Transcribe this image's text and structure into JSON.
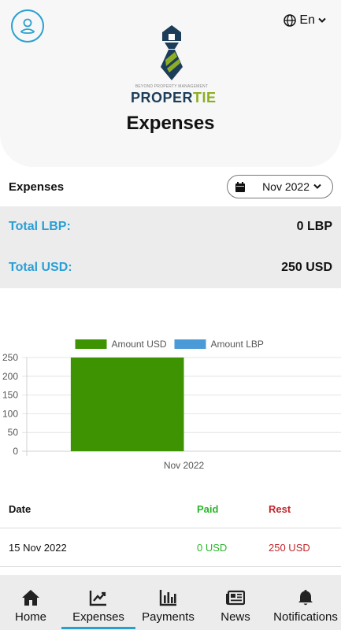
{
  "header": {
    "language": "En",
    "logo_tagline": "BEYOND PROPERTY MANAGEMENT",
    "logo_brand_main": "PROPER",
    "logo_brand_accent": "TIE",
    "title": "Expenses"
  },
  "filter": {
    "section_label": "Expenses",
    "selected_month": "Nov 2022"
  },
  "totals": [
    {
      "label": "Total LBP:",
      "value": "0 LBP"
    },
    {
      "label": "Total USD:",
      "value": "250 USD"
    }
  ],
  "chart_data": {
    "type": "bar",
    "categories": [
      "Nov 2022"
    ],
    "series": [
      {
        "name": "Amount USD",
        "values": [
          250
        ],
        "color": "#3e9303"
      },
      {
        "name": "Amount LBP",
        "values": [
          0
        ],
        "color": "#4a9ad8"
      }
    ],
    "y_ticks": [
      0,
      50,
      100,
      150,
      200,
      250
    ],
    "ylim": [
      0,
      250
    ],
    "legend": "top",
    "grid": true
  },
  "table": {
    "columns": [
      "Date",
      "Paid",
      "Rest"
    ],
    "column_colors": [
      "#111111",
      "#2ab52a",
      "#c0262b"
    ],
    "rows": [
      {
        "date": "15 Nov 2022",
        "paid": "0 USD",
        "rest": "250 USD"
      }
    ]
  },
  "nav": [
    {
      "label": "Home",
      "icon": "home-icon",
      "active": false
    },
    {
      "label": "Expenses",
      "icon": "chart-icon",
      "active": true
    },
    {
      "label": "Payments",
      "icon": "bar-chart-icon",
      "active": false
    },
    {
      "label": "News",
      "icon": "newspaper-icon",
      "active": false
    },
    {
      "label": "Notifications",
      "icon": "bell-icon",
      "active": false
    }
  ]
}
